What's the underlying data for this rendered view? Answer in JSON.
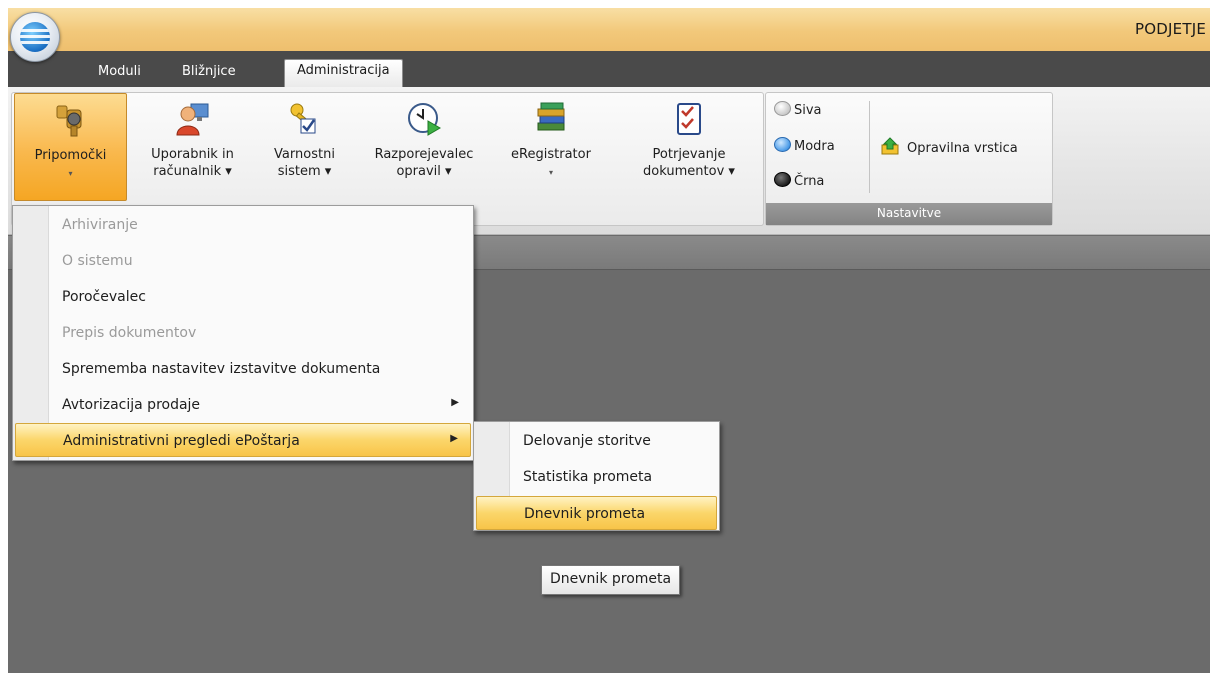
{
  "app": {
    "title": "PODJETJE"
  },
  "tabs": [
    {
      "label": "Moduli"
    },
    {
      "label": "Bližnjice"
    },
    {
      "label": "Administracija",
      "active": true
    }
  ],
  "ribbon": {
    "buttons": [
      {
        "line1": "Pripomočki",
        "line2": "▾",
        "icon": "wrench-tools-icon",
        "selected": true
      },
      {
        "line1": "Uporabnik in",
        "line2": "računalnik ▾",
        "icon": "user-computer-icon"
      },
      {
        "line1": "Varnostni",
        "line2": "sistem ▾",
        "icon": "keys-security-icon"
      },
      {
        "line1": "Razporejevalec",
        "line2": "opravil ▾",
        "icon": "clock-scheduler-icon"
      },
      {
        "line1": "eRegistrator",
        "line2": "▾",
        "icon": "books-registry-icon"
      },
      {
        "line1": "Potrjevanje",
        "line2": "dokumentov ▾",
        "icon": "checklist-icon"
      }
    ],
    "settings": {
      "themes": [
        {
          "label": "Siva",
          "color": "#c9c9c9"
        },
        {
          "label": "Modra",
          "color": "#4a9be8"
        },
        {
          "label": "Črna",
          "color": "#1c1c1c"
        }
      ],
      "taskbar_label": "Opravilna vrstica",
      "group_label": "Nastavitve"
    }
  },
  "menu": {
    "items": [
      {
        "label": "Arhiviranje",
        "disabled": true
      },
      {
        "label": "O sistemu",
        "disabled": true
      },
      {
        "label": "Poročevalec",
        "disabled": false
      },
      {
        "label": "Prepis dokumentov",
        "disabled": true
      },
      {
        "label": "Sprememba nastavitev izstavitve dokumenta",
        "disabled": false
      },
      {
        "label": "Avtorizacija prodaje",
        "disabled": false,
        "submenu": true
      },
      {
        "label": "Administrativni pregledi ePoštarja",
        "disabled": false,
        "submenu": true,
        "highlighted": true
      }
    ],
    "submenu_arrow": "▶"
  },
  "submenu": {
    "items": [
      {
        "label": "Delovanje storitve"
      },
      {
        "label": "Statistika prometa"
      },
      {
        "label": "Dnevnik prometa",
        "highlighted": true
      }
    ]
  },
  "tooltip": {
    "text": "Dnevnik prometa"
  },
  "colors": {
    "accent": "#f9b84d",
    "titlebar": "#f2c87a",
    "workspace": "#6b6b6b"
  }
}
